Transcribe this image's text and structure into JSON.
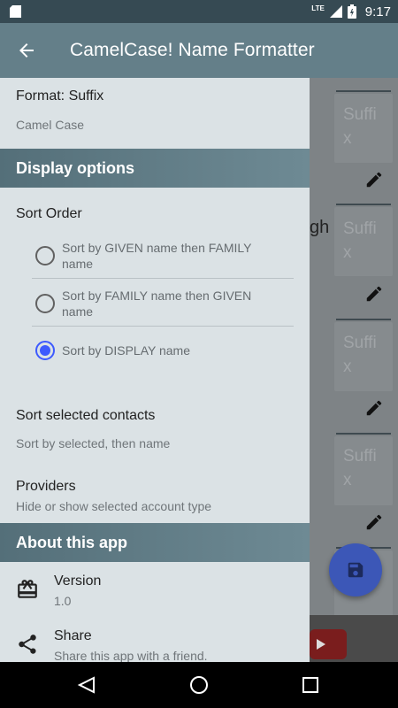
{
  "status_bar": {
    "time": "9:17",
    "network": "LTE",
    "icons": [
      "sd-card-icon",
      "signal-icon",
      "battery-icon"
    ]
  },
  "app_bar": {
    "title": "CamelCase! Name Formatter"
  },
  "drawer": {
    "format": {
      "title": "Format: Suffix",
      "subtitle": "Camel Case"
    },
    "display_options_header": "Display options",
    "sort_order": {
      "title": "Sort Order",
      "options": [
        {
          "label": "Sort by GIVEN name then FAMILY name",
          "selected": false
        },
        {
          "label": "Sort by FAMILY name then GIVEN name",
          "selected": false
        },
        {
          "label": "Sort by DISPLAY name",
          "selected": true
        }
      ]
    },
    "sort_selected": {
      "title": "Sort selected contacts",
      "subtitle": "Sort by selected, then name"
    },
    "providers": {
      "title": "Providers",
      "subtitle": "Hide or show selected account type"
    },
    "about_header": "About this app",
    "version": {
      "title": "Version",
      "subtitle": "1.0"
    },
    "share": {
      "title": "Share",
      "subtitle": "Share this app with a friend."
    }
  },
  "background": {
    "suffix_labels": [
      "Suffi",
      "x",
      "Suffi",
      "x",
      "Suffi",
      "x",
      "Suffi",
      "x"
    ],
    "partial_text": "gh"
  },
  "colors": {
    "accent": "#3d5afe",
    "fab": "#3c57b7",
    "app_bar": "#647f89",
    "status_bar": "#364a53",
    "drawer_bg": "#dbe2e5"
  }
}
